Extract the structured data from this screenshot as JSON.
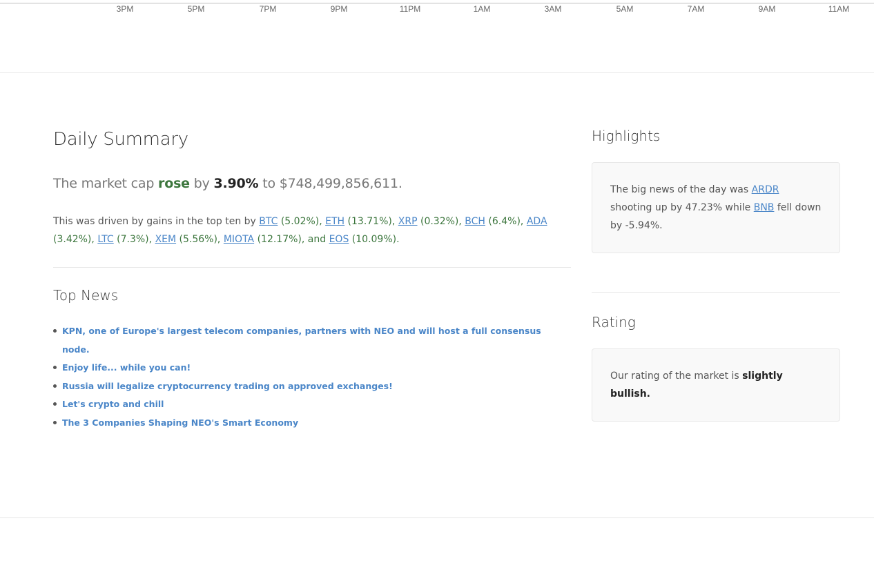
{
  "chart_axis": {
    "ticks": [
      "3PM",
      "5PM",
      "7PM",
      "9PM",
      "11PM",
      "1AM",
      "3AM",
      "5AM",
      "7AM",
      "9AM",
      "11AM"
    ]
  },
  "summary": {
    "title": "Daily Summary",
    "market": {
      "prefix": "The market cap",
      "direction": "rose",
      "by_word": "by",
      "change_pct": "3.90%",
      "to_word": "to",
      "cap_value": "$748,499,856,611."
    },
    "driven_prefix": "This was driven by gains in the top ten by",
    "gainers": [
      {
        "symbol": "BTC",
        "pct": "(5.02%),"
      },
      {
        "symbol": "ETH",
        "pct": "(13.71%),"
      },
      {
        "symbol": "XRP",
        "pct": "(0.32%),"
      },
      {
        "symbol": "BCH",
        "pct": "(6.4%),"
      },
      {
        "symbol": "ADA",
        "pct": "(3.42%),"
      },
      {
        "symbol": "LTC",
        "pct": "(7.3%),"
      },
      {
        "symbol": "XEM",
        "pct": "(5.56%),"
      },
      {
        "symbol": "MIOTA",
        "pct": "(12.17%), and"
      },
      {
        "symbol": "EOS",
        "pct": "(10.09%)."
      }
    ]
  },
  "news": {
    "title": "Top News",
    "items": [
      "KPN, one of Europe's largest telecom companies, partners with NEO and will host a full consensus node.",
      "Enjoy life... while you can!",
      "Russia will legalize cryptocurrency trading on approved exchanges!",
      "Let's crypto and chill",
      "The 3 Companies Shaping NEO's Smart Economy"
    ]
  },
  "highlights": {
    "title": "Highlights",
    "text_1": "The big news of the day was",
    "coin_up": "ARDR",
    "text_2": "shooting up by 47.23% while",
    "coin_down": "BNB",
    "text_3": "fell down by -5.94%."
  },
  "rating": {
    "title": "Rating",
    "prefix": "Our rating of the market is",
    "value": "slightly bullish."
  },
  "colors": {
    "link": "#4a86c8",
    "gain": "#3c763d",
    "card_bg": "#f9f9f9"
  }
}
